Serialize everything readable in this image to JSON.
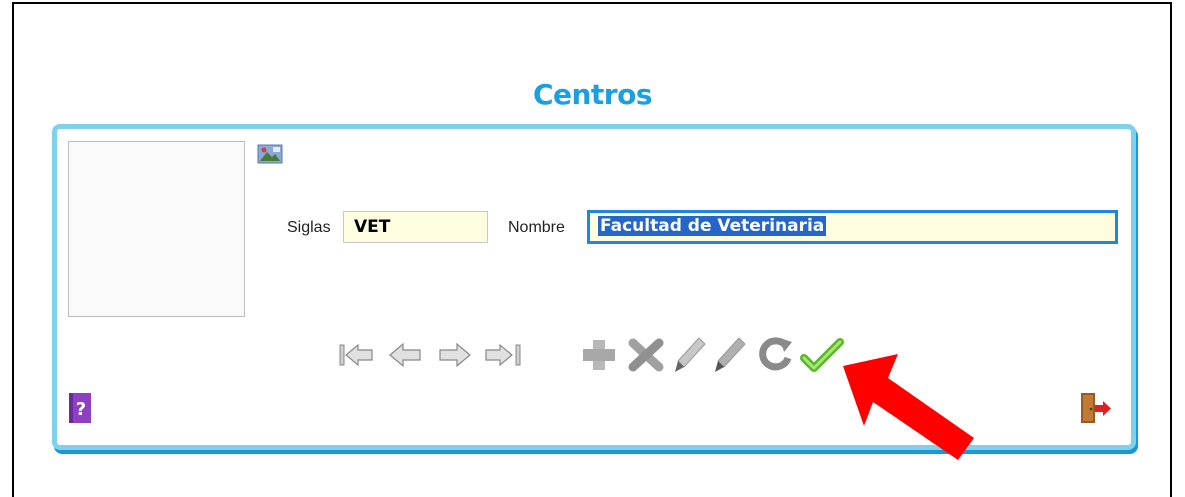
{
  "form": {
    "title": "Centros",
    "siglas_label": "Siglas",
    "siglas_value": "VET",
    "nombre_label": "Nombre",
    "nombre_value": "Facultad de Veterinaria"
  },
  "icons": {
    "image": "image-icon",
    "first": "first-record-icon",
    "prev": "previous-record-icon",
    "next": "next-record-icon",
    "last": "last-record-icon",
    "add": "add-icon",
    "delete": "delete-icon",
    "edit": "edit-icon",
    "edit_alt": "edit-alt-icon",
    "refresh": "refresh-icon",
    "confirm": "confirm-icon",
    "help": "help-icon",
    "exit": "exit-icon"
  },
  "colors": {
    "title": "#1a9fe0",
    "panel_border": "#7fd0ec",
    "panel_shadow": "#1e96d2",
    "field_bg": "#fffde0",
    "focus_border": "#1e88d6",
    "annotation_arrow": "#ff0000"
  }
}
